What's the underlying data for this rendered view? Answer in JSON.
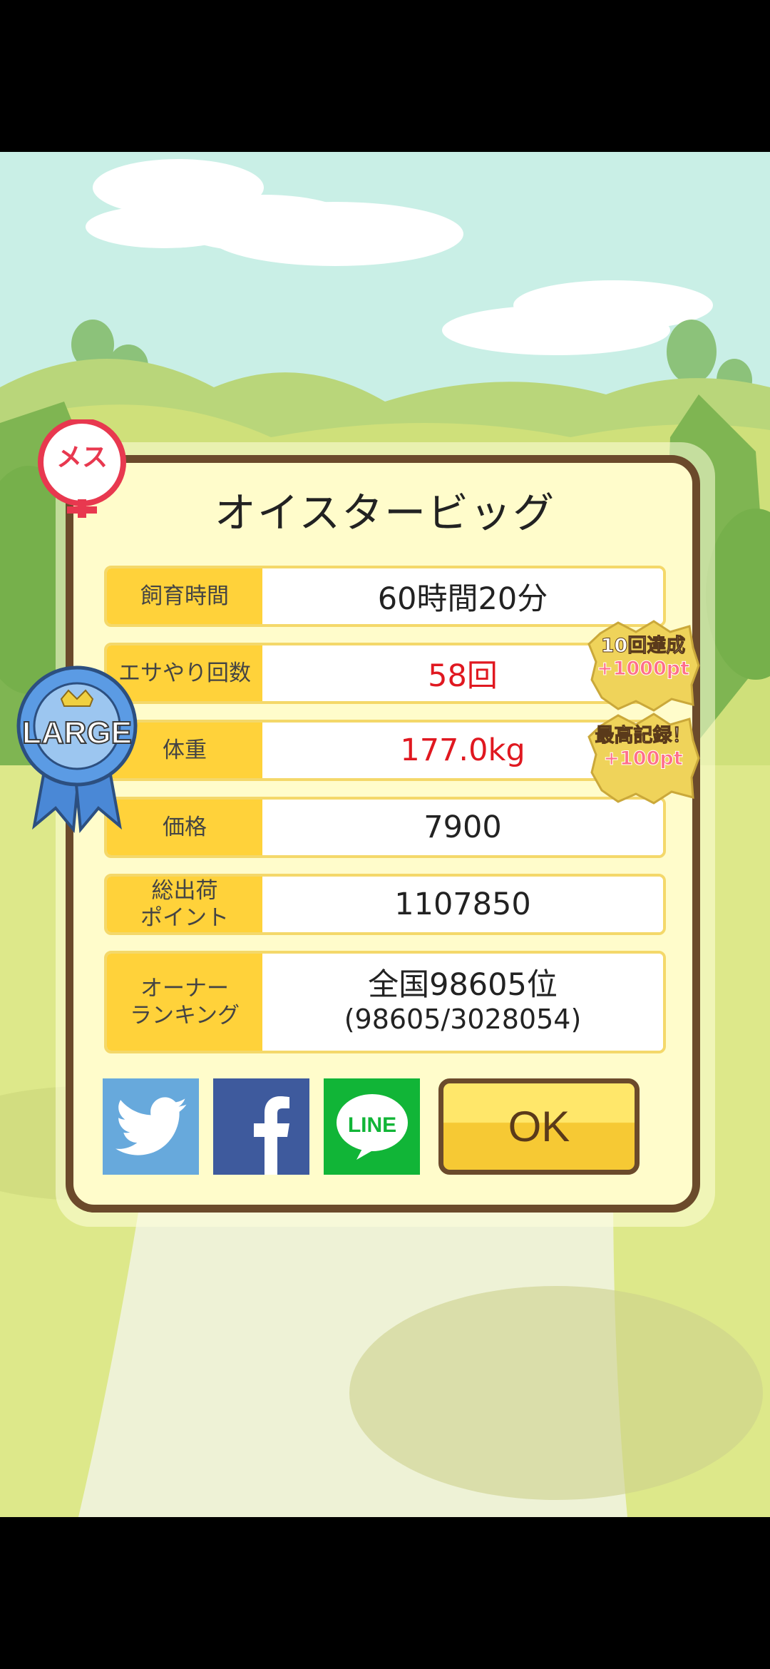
{
  "dialog": {
    "title": "オイスタービッグ",
    "rows": [
      {
        "label": "飼育時間",
        "value": "60時間20分"
      },
      {
        "label": "エサやり回数",
        "value": "58回"
      },
      {
        "label": "体重",
        "value": "177.0kg"
      },
      {
        "label": "価格",
        "value": "7900"
      },
      {
        "label_line1": "総出荷",
        "label_line2": "ポイント",
        "value": "1107850"
      },
      {
        "label_line1": "オーナー",
        "label_line2": "ランキング",
        "value_line1": "全国98605位",
        "value_line2": "(98605/3028054)"
      }
    ],
    "ok_label": "OK",
    "highlight_color": "#e01820"
  },
  "badges": {
    "feed_bonus": {
      "line1": "10回達成",
      "line2": "+1000pt"
    },
    "record_bonus": {
      "line1": "最高記録！",
      "line2": "+100pt"
    }
  },
  "ribbon": {
    "label": "LARGE"
  },
  "gender": {
    "label": "メス"
  },
  "social": {
    "twitter": {
      "icon": "twitter-bird-icon",
      "color": "#67a9dc"
    },
    "facebook": {
      "icon": "facebook-f-icon",
      "color": "#3e5a9d"
    },
    "line": {
      "icon": "line-icon",
      "label": "LINE",
      "color": "#11b537"
    }
  }
}
